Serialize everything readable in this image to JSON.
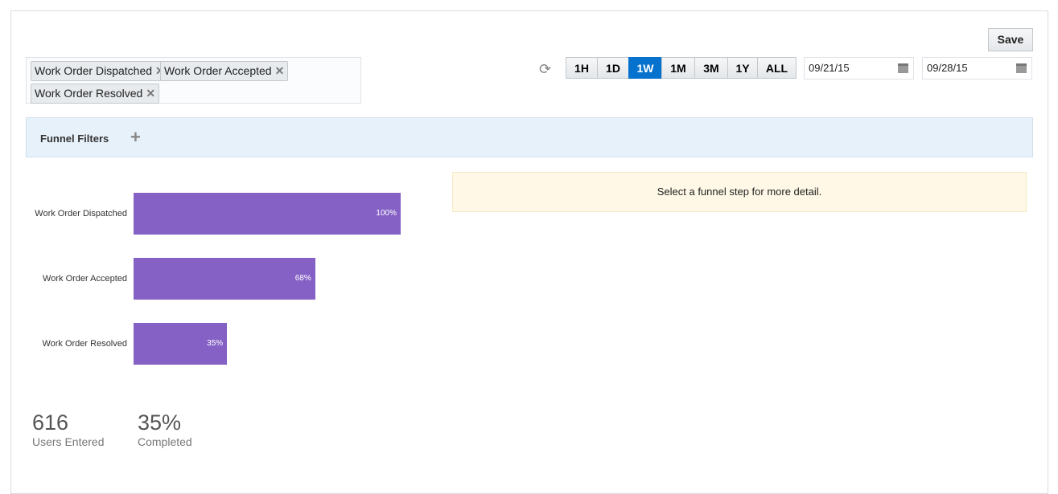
{
  "toolbar": {
    "save": "Save",
    "ranges": [
      "1H",
      "1D",
      "1W",
      "1M",
      "3M",
      "1Y",
      "ALL"
    ],
    "active_range": "1W",
    "start_date": "09/21/15",
    "end_date": "09/28/15"
  },
  "tags": [
    "Work Order Dispatched",
    "Work Order Accepted",
    "Work Order Resolved"
  ],
  "filters": {
    "label": "Funnel Filters"
  },
  "funnel": [
    {
      "label": "Work Order Dispatched",
      "percent": 100,
      "text": "100%"
    },
    {
      "label": "Work Order Accepted",
      "percent": 68,
      "text": "68%"
    },
    {
      "label": "Work Order Resolved",
      "percent": 35,
      "text": "35%"
    }
  ],
  "detail_note": "Select a funnel step for more detail.",
  "stats": {
    "users_value": "616",
    "users_label": "Users Entered",
    "completed_value": "35%",
    "completed_label": "Completed"
  },
  "colors": {
    "bar": "#8561c5",
    "active": "#0572ce"
  }
}
